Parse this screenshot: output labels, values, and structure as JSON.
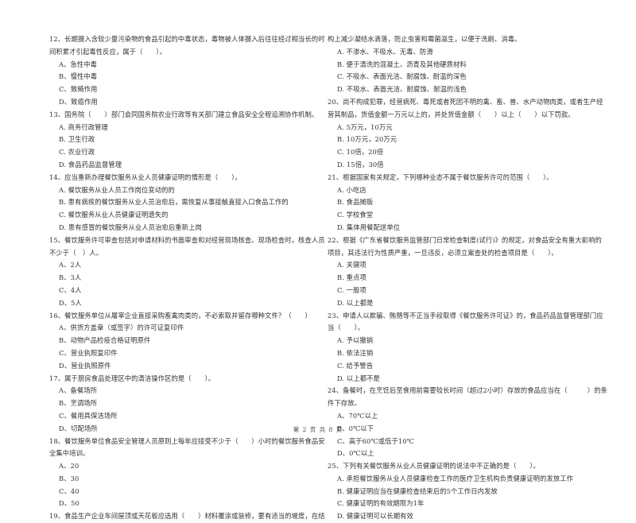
{
  "left_column": [
    {
      "text": "12、长期摄入含较少量污染物的食品引起的中毒状态，毒物被人体摄入后往往经过相当长的时",
      "type": "q"
    },
    {
      "text": "间积累才引起毒性反应，属于（　　）。",
      "type": "q"
    },
    {
      "text": "A、急性中毒",
      "type": "opt"
    },
    {
      "text": "B、慢性中毒",
      "type": "opt"
    },
    {
      "text": "C、致畸作用",
      "type": "opt"
    },
    {
      "text": "D、致癌作用",
      "type": "opt"
    },
    {
      "text": "13、国务院（　　）部门会同国务院农业行政等有关部门建立食品安全全程追溯协作机制。",
      "type": "q"
    },
    {
      "text": "A. 商务行政管理",
      "type": "opt"
    },
    {
      "text": "B. 卫生行政",
      "type": "opt"
    },
    {
      "text": "C. 农业行政",
      "type": "opt"
    },
    {
      "text": "D. 食品药品监督管理",
      "type": "opt"
    },
    {
      "text": "14、应当重新办理餐饮服务从业人员健康证明的情形是（　　）。",
      "type": "q"
    },
    {
      "text": "A. 餐饮服务从业人员工作岗位变动的的",
      "type": "opt"
    },
    {
      "text": "B. 患有病疾的餐饮服务从业人员治愈后，需恢复从事接触直接入口食品工作的",
      "type": "opt"
    },
    {
      "text": "C. 餐饮服务从业人员健康证明遗失的",
      "type": "opt"
    },
    {
      "text": "D. 患有感冒的餐饮服务从业人员治愈后重新上岗",
      "type": "opt"
    },
    {
      "text": "15、餐饮服务许可审查包括对申请材料的书面审查和对经营现场核查。现场检查时，核查人员",
      "type": "q"
    },
    {
      "text": "不少于（　）人。",
      "type": "q"
    },
    {
      "text": "A、2人",
      "type": "opt"
    },
    {
      "text": "B、3人",
      "type": "opt"
    },
    {
      "text": "C、4人",
      "type": "opt"
    },
    {
      "text": "D、5人",
      "type": "opt"
    },
    {
      "text": "16、餐饮服务单位从屠宰企业直接采购畜禽肉类的，不必索取并留存哪种文件？（　　）",
      "type": "q"
    },
    {
      "text": "A、供货方盖章（或签字）的许可证复印件",
      "type": "opt"
    },
    {
      "text": "B、动物产品检疫合格证明原件",
      "type": "opt"
    },
    {
      "text": "C、营业执照复印件",
      "type": "opt"
    },
    {
      "text": "D、营业执照原件",
      "type": "opt"
    },
    {
      "text": "17、属于厨房食品处理区中的清洁操作区的是（　　）。",
      "type": "q"
    },
    {
      "text": "A、备餐场所",
      "type": "opt"
    },
    {
      "text": "B、烹调场所",
      "type": "opt"
    },
    {
      "text": "C、餐用具保洁场所",
      "type": "opt"
    },
    {
      "text": "D、切配场所",
      "type": "opt"
    },
    {
      "text": "18、餐饮服务单位食品安全管理人员原则上每年应接受不少于（　　）小时的餐饮服务食品安",
      "type": "q"
    },
    {
      "text": "全集中培训。",
      "type": "q"
    },
    {
      "text": "A、20",
      "type": "opt"
    },
    {
      "text": "B、30",
      "type": "opt"
    },
    {
      "text": "C、40",
      "type": "opt"
    },
    {
      "text": "D、50",
      "type": "opt"
    },
    {
      "text": "19、食品生产企业车间屋顶或天花板应选用（　　）材料覆涂或装修，要有适当的坡度，在结",
      "type": "q"
    }
  ],
  "right_column": [
    {
      "text": "构上减少凝结水滴落，防止虫害和霉菌滋生，以便于洗刷、消毒。",
      "type": "q"
    },
    {
      "text": "A. 不渗水、不吸水、无毒、防滑",
      "type": "opt"
    },
    {
      "text": "B. 便于清洗的混凝土、沥青及其他硬质材料",
      "type": "opt"
    },
    {
      "text": "C. 不吸水、表面光洁、耐腐蚀、耐温的深色",
      "type": "opt"
    },
    {
      "text": "D. 不吸水、表面光洁、耐腐蚀、耐温的浅色",
      "type": "opt"
    },
    {
      "text": "20、尚不构成犯罪，经营病死、毒死或者死因不明的禽、畜、兽、水产动物肉类，或者生产经",
      "type": "q"
    },
    {
      "text": "营其制品，货值金额一万元以上的，并处货值金额（　　）以上（　　）以下罚款。",
      "type": "q"
    },
    {
      "text": "A. 5万元，10万元",
      "type": "opt"
    },
    {
      "text": "B. 10万元，20万元",
      "type": "opt"
    },
    {
      "text": "C. 10倍，20倍",
      "type": "opt"
    },
    {
      "text": "D. 15倍，30倍",
      "type": "opt"
    },
    {
      "text": "21、根据国家有关规定，下列哪种业态不属于餐饮服务许可的范围（　　）。",
      "type": "q"
    },
    {
      "text": "A. 小吃店",
      "type": "opt"
    },
    {
      "text": "B. 食品摊贩",
      "type": "opt"
    },
    {
      "text": "C. 学校食堂",
      "type": "opt"
    },
    {
      "text": "D. 集体用餐配送单位",
      "type": "opt"
    },
    {
      "text": "22、根据《广东省餐饮服务监管部门日常检查制度(试行)》的规定，对食品安全有重大影响的",
      "type": "q"
    },
    {
      "text": "项目，其违法行为性质严重，一旦违反，必须立案查处的检查项目是（　　）。",
      "type": "q"
    },
    {
      "text": "A. 关键项",
      "type": "opt"
    },
    {
      "text": "B. 重点项",
      "type": "opt"
    },
    {
      "text": "C. 一般项",
      "type": "opt"
    },
    {
      "text": "D. 以上都是",
      "type": "opt"
    },
    {
      "text": "23、申请人以欺骗、贿赂等不正当手段取得《餐饮服务许可证》的，食品药品监督管理部门应",
      "type": "q"
    },
    {
      "text": "当（　　）。",
      "type": "q"
    },
    {
      "text": "A. 予以撤销",
      "type": "opt"
    },
    {
      "text": "B. 依法注销",
      "type": "opt"
    },
    {
      "text": "C. 给予警告",
      "type": "opt"
    },
    {
      "text": "D. 以上都不是",
      "type": "opt"
    },
    {
      "text": "24、备餐时，在烹饪后至食用前需要较长时间（超过2小时）存放的食品应当在（　　　）的条",
      "type": "q"
    },
    {
      "text": "件下存放。",
      "type": "q"
    },
    {
      "text": "A、70℃以上",
      "type": "opt"
    },
    {
      "text": "B、0℃以下",
      "type": "opt"
    },
    {
      "text": "C、高于60℃或低于10℃",
      "type": "opt"
    },
    {
      "text": "D、0℃以上",
      "type": "opt"
    },
    {
      "text": "25、下列有关餐饮服务从业人员健康证明的说法中不正确的是（　　）。",
      "type": "q"
    },
    {
      "text": "A. 承担餐饮服务从业人员健康检查工作的医疗卫生机构负责健康证明的发放工作",
      "type": "opt"
    },
    {
      "text": "B. 健康证明应当在健康检查结束后的5个工作日内发放",
      "type": "opt"
    },
    {
      "text": "C. 健康证明的有效期限为1年",
      "type": "opt"
    },
    {
      "text": "D. 健康证明可以长期有效",
      "type": "opt"
    }
  ],
  "footer": {
    "page_label": "第 2 页 共 8 页"
  }
}
